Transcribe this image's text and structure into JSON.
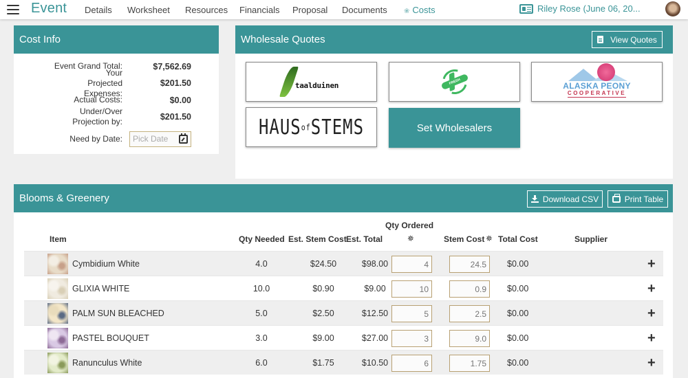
{
  "nav": {
    "brand": "Event",
    "links": [
      {
        "label": "Details"
      },
      {
        "label": "Worksheet"
      },
      {
        "label": "Resources"
      },
      {
        "label": "Financials"
      },
      {
        "label": "Proposal"
      },
      {
        "label": "Documents"
      },
      {
        "label": "Costs",
        "active": true
      }
    ],
    "client": "Riley Rose (June 06, 20...",
    "menu_icon": "hamburger-icon",
    "client_icon": "id-card-icon",
    "costs_icon": "leaf-icon"
  },
  "cost_info": {
    "title": "Cost Info",
    "rows": [
      {
        "label": "Event Grand Total:",
        "value": "$7,562.69"
      },
      {
        "label": "Your Projected Expenses:",
        "value": "$201.50"
      },
      {
        "label": "Actual Costs:",
        "value": "$0.00"
      },
      {
        "label": "Under/Over Projection by:",
        "value": "$201.50"
      }
    ],
    "need_by_label": "Need by Date:",
    "need_by_placeholder": "Pick Date",
    "need_by_value": ""
  },
  "wholesale_quotes": {
    "title": "Wholesale Quotes",
    "view_quotes_label": "View Quotes",
    "wholesalers": [
      {
        "name": "Staalduinen",
        "logo_text": "taalduinen"
      },
      {
        "name": "Fresh",
        "logo_text": "FRESH"
      },
      {
        "name": "Alaska Peony Cooperative",
        "logo_text_1": "ALASKA PEONY",
        "logo_text_2": "COOPERATIVE"
      },
      {
        "name": "Haus of Stems",
        "logo_text": "HAUS",
        "logo_mid": "of",
        "logo_text_2": "STEMS"
      }
    ],
    "set_wholesalers_label": "Set Wholesalers"
  },
  "blooms": {
    "title": "Blooms & Greenery",
    "download_csv_label": "Download CSV",
    "print_table_label": "Print Table",
    "columns": {
      "item": "Item",
      "qty_needed": "Qty Needed",
      "est_stem_cost": "Est. Stem Cost",
      "est_total": "Est. Total",
      "qty_ordered": "Qty Ordered",
      "stem_cost": "Stem Cost",
      "total_cost": "Total Cost",
      "supplier": "Supplier"
    },
    "rows": [
      {
        "item": "Cymbidium White",
        "qty_needed": "4.0",
        "est_stem_cost": "$24.50",
        "est_total": "$98.00",
        "qty_ordered_placeholder": "4",
        "stem_cost_placeholder": "24.5",
        "total_cost": "$0.00",
        "supplier": "",
        "thumb": [
          "#e8dcc8",
          "#c7a089",
          "#f3eee4"
        ]
      },
      {
        "item": "GLIXIA WHITE",
        "qty_needed": "10.0",
        "est_stem_cost": "$0.90",
        "est_total": "$9.00",
        "qty_ordered_placeholder": "10",
        "stem_cost_placeholder": "0.9",
        "total_cost": "$0.00",
        "supplier": "",
        "thumb": [
          "#f0ebe0",
          "#d9cfb6",
          "#f7f4ee"
        ]
      },
      {
        "item": "PALM SUN BLEACHED",
        "qty_needed": "5.0",
        "est_stem_cost": "$2.50",
        "est_total": "$12.50",
        "qty_ordered_placeholder": "5",
        "stem_cost_placeholder": "2.5",
        "total_cost": "$0.00",
        "supplier": "",
        "thumb": [
          "#f3e6c8",
          "#5a6a84",
          "#e9dcbc"
        ]
      },
      {
        "item": "PASTEL BOUQUET",
        "qty_needed": "3.0",
        "est_stem_cost": "$9.00",
        "est_total": "$27.00",
        "qty_ordered_placeholder": "3",
        "stem_cost_placeholder": "9.0",
        "total_cost": "$0.00",
        "supplier": "",
        "thumb": [
          "#d9c9e4",
          "#8d6a96",
          "#efe6f2"
        ]
      },
      {
        "item": "Ranunculus White",
        "qty_needed": "6.0",
        "est_stem_cost": "$1.75",
        "est_total": "$10.50",
        "qty_ordered_placeholder": "6",
        "stem_cost_placeholder": "1.75",
        "total_cost": "$0.00",
        "supplier": "",
        "thumb": [
          "#e3ebc9",
          "#8a9a5a",
          "#f2f4e2"
        ]
      }
    ],
    "add_icon": "plus-icon",
    "wand_icon": "magic-wand-icon"
  },
  "colors": {
    "accent": "#3a9497",
    "input_border": "#b8a072",
    "input_placeholder": "#f2c9d3"
  }
}
